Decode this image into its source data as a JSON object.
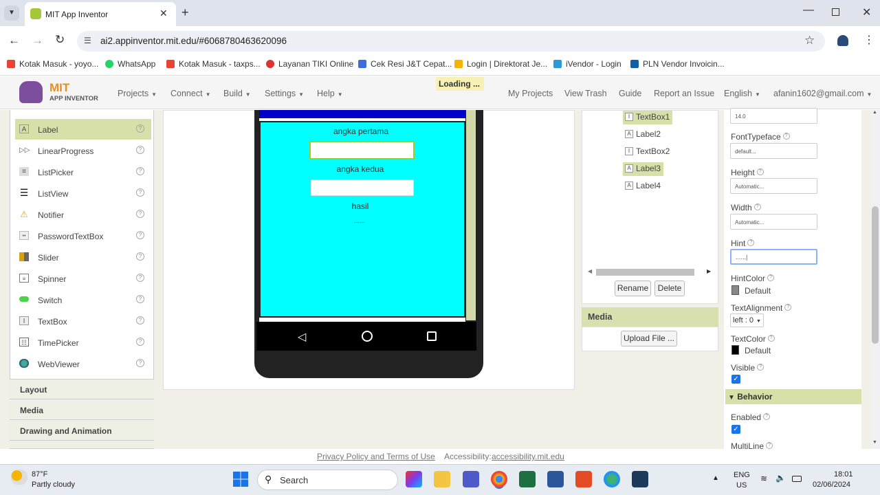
{
  "browser": {
    "tab_title": "MIT App Inventor",
    "url": "ai2.appinventor.mit.edu/#6068780463620096",
    "bookmarks": [
      "Kotak Masuk - yoyo...",
      "WhatsApp",
      "Kotak Masuk - taxps...",
      "Layanan TIKI Online",
      "Cek Resi J&T Cepat...",
      "Login | Direktorat Je...",
      "iVendor - Login",
      "PLN Vendor Invoicin..."
    ]
  },
  "header": {
    "logo_mit": "MIT",
    "logo_sub": "APP INVENTOR",
    "menus": [
      "Projects",
      "Connect",
      "Build",
      "Settings",
      "Help"
    ],
    "loading": "Loading ...",
    "links": [
      "My Projects",
      "View Trash",
      "Guide",
      "Report an Issue"
    ],
    "language": "English",
    "account": "afanin1602@gmail.com"
  },
  "palette": {
    "items": [
      {
        "label": "Label",
        "icon": "label-icon"
      },
      {
        "label": "LinearProgress",
        "icon": "progress-icon"
      },
      {
        "label": "ListPicker",
        "icon": "listpicker-icon"
      },
      {
        "label": "ListView",
        "icon": "listview-icon"
      },
      {
        "label": "Notifier",
        "icon": "warning-icon"
      },
      {
        "label": "PasswordTextBox",
        "icon": "password-icon"
      },
      {
        "label": "Slider",
        "icon": "slider-icon"
      },
      {
        "label": "Spinner",
        "icon": "spinner-icon"
      },
      {
        "label": "Switch",
        "icon": "switch-icon"
      },
      {
        "label": "TextBox",
        "icon": "textbox-icon"
      },
      {
        "label": "TimePicker",
        "icon": "timepicker-icon"
      },
      {
        "label": "WebViewer",
        "icon": "globe-icon"
      }
    ],
    "sections": [
      "Layout",
      "Media",
      "Drawing and Animation"
    ]
  },
  "viewer": {
    "label1": "angka pertama",
    "label2": "angka kedua",
    "label3": "hasil",
    "label4": "......"
  },
  "components": {
    "items": [
      {
        "name": "TextBox1",
        "icon": "textbox-icon"
      },
      {
        "name": "Label2",
        "icon": "label-icon"
      },
      {
        "name": "TextBox2",
        "icon": "textbox-icon"
      },
      {
        "name": "Label3",
        "icon": "label-icon"
      },
      {
        "name": "Label4",
        "icon": "label-icon"
      }
    ],
    "rename": "Rename",
    "delete": "Delete"
  },
  "media": {
    "title": "Media",
    "upload": "Upload File ..."
  },
  "properties": {
    "fontsize_value": "14.0",
    "fonttypeface_label": "FontTypeface",
    "fonttypeface_value": "default...",
    "height_label": "Height",
    "height_value": "Automatic...",
    "width_label": "Width",
    "width_value": "Automatic...",
    "hint_label": "Hint",
    "hint_value": "......|",
    "hintcolor_label": "HintColor",
    "hintcolor_value": "Default",
    "textalignment_label": "TextAlignment",
    "textalignment_value": "left : 0",
    "textcolor_label": "TextColor",
    "textcolor_value": "Default",
    "visible_label": "Visible",
    "behavior_label": "Behavior",
    "enabled_label": "Enabled",
    "multiline_label": "MultiLine"
  },
  "footer": {
    "privacy": "Privacy Policy and Terms of Use",
    "accessibility_label": "Accessibility:",
    "accessibility_link": "accessibility.mit.edu"
  },
  "taskbar": {
    "temp": "87°F",
    "weather": "Partly cloudy",
    "search": "Search",
    "lang1": "ENG",
    "lang2": "US",
    "time": "18:01",
    "date": "02/06/2024"
  }
}
